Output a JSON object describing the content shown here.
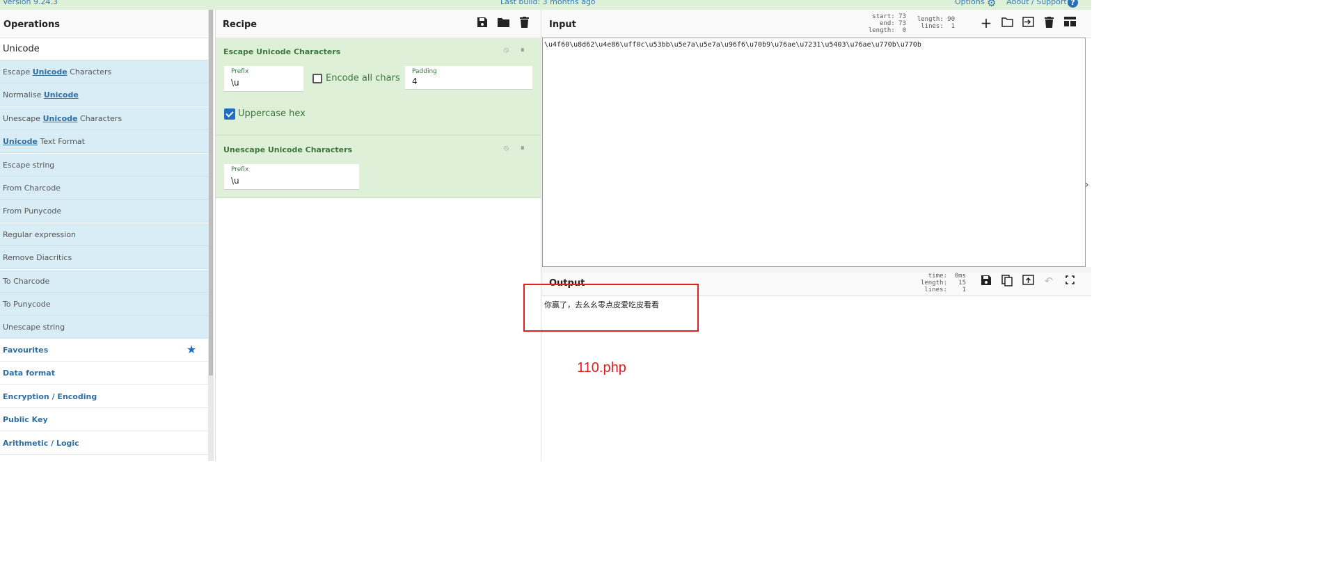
{
  "header": {
    "version": "Version 9.24.3",
    "last_build": "Last build: 3 months ago",
    "options": "Options",
    "about": "About / Support"
  },
  "operations": {
    "title": "Operations",
    "search_value": "Unicode",
    "results": [
      {
        "pre": "Escape ",
        "hl": "Unicode",
        "post": " Characters"
      },
      {
        "pre": "Normalise ",
        "hl": "Unicode",
        "post": ""
      },
      {
        "pre": "Unescape ",
        "hl": "Unicode",
        "post": " Characters"
      },
      {
        "pre": "",
        "hl": "Unicode",
        "post": " Text Format"
      },
      {
        "pre": "Escape string",
        "hl": "",
        "post": ""
      },
      {
        "pre": "From Charcode",
        "hl": "",
        "post": ""
      },
      {
        "pre": "From Punycode",
        "hl": "",
        "post": ""
      },
      {
        "pre": "Regular expression",
        "hl": "",
        "post": ""
      },
      {
        "pre": "Remove Diacritics",
        "hl": "",
        "post": ""
      },
      {
        "pre": "To Charcode",
        "hl": "",
        "post": ""
      },
      {
        "pre": "To Punycode",
        "hl": "",
        "post": ""
      },
      {
        "pre": "Unescape string",
        "hl": "",
        "post": ""
      }
    ],
    "categories": [
      "Favourites",
      "Data format",
      "Encryption / Encoding",
      "Public Key",
      "Arithmetic / Logic"
    ]
  },
  "recipe": {
    "title": "Recipe",
    "op1": {
      "title": "Escape Unicode Characters",
      "prefix_label": "Prefix",
      "prefix_value": "\\u",
      "encode_all_label": "Encode all chars",
      "encode_all_checked": false,
      "padding_label": "Padding",
      "padding_value": "4",
      "uppercase_label": "Uppercase hex",
      "uppercase_checked": true
    },
    "op2": {
      "title": "Unescape Unicode Characters",
      "prefix_label": "Prefix",
      "prefix_value": "\\u"
    }
  },
  "input": {
    "title": "Input",
    "stats_left": "start: 73\n  end: 73\nlength:  0",
    "stats_right": "length: 90\n lines:  1",
    "text": "\\u4f60\\u8d62\\u4e86\\uff0c\\u53bb\\u5e7a\\u5e7a\\u96f6\\u70b9\\u76ae\\u7231\\u5403\\u76ae\\u770b\\u770b"
  },
  "output": {
    "title": "Output",
    "stats": "  time:  0ms\nlength:   15\n lines:    1",
    "text": "你赢了，去幺幺零点皮爱吃皮看看"
  },
  "annotation": {
    "label": "110.php",
    "color": "#e02020"
  },
  "colors": {
    "accent": "#2f6ea1",
    "recipe_bg": "#dff0d8",
    "ops_bg": "#d9edf7"
  }
}
